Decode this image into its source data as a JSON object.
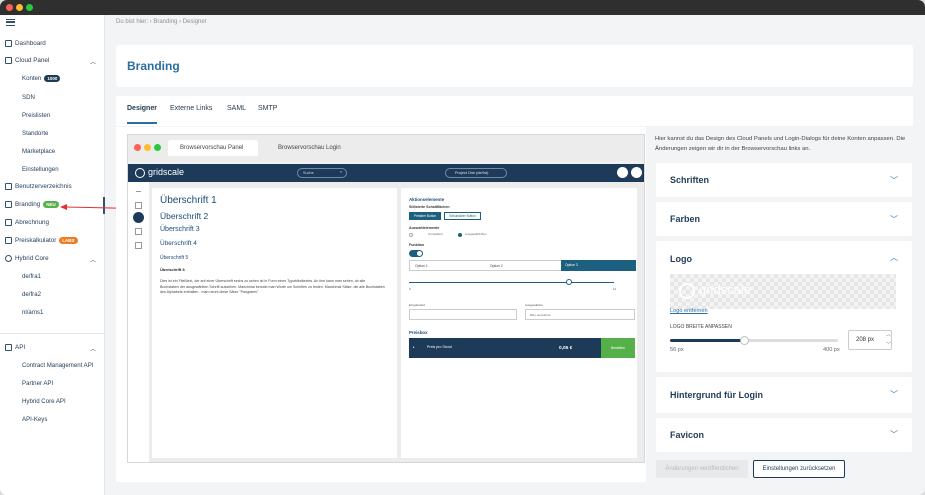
{
  "breadcrumb": "Du bist hier: › Branding › Designer",
  "page_title": "Branding",
  "sidebar": {
    "items": [
      {
        "label": "Dashboard"
      },
      {
        "label": "Cloud Panel"
      },
      {
        "label": "Konten",
        "badge": "1000"
      },
      {
        "label": "SDN"
      },
      {
        "label": "Preislisten"
      },
      {
        "label": "Standorte"
      },
      {
        "label": "Marketplace"
      },
      {
        "label": "Einstellungen"
      },
      {
        "label": "Benutzerverzeichnis"
      },
      {
        "label": "Branding",
        "badge": "NEU"
      },
      {
        "label": "Abrechnung"
      },
      {
        "label": "Preiskalkulator",
        "badge": "LABS"
      },
      {
        "label": "Hybrid Core"
      },
      {
        "label": "de/fra1"
      },
      {
        "label": "de/fra2"
      },
      {
        "label": "nl/ams1"
      },
      {
        "label": "API"
      },
      {
        "label": "Contract Management API"
      },
      {
        "label": "Partner API"
      },
      {
        "label": "Hybrid Core API"
      },
      {
        "label": "API-Keys"
      }
    ]
  },
  "tabs": [
    "Designer",
    "Externe Links",
    "SAML",
    "SMTP"
  ],
  "preview": {
    "tab1": "Browservorschau Panel",
    "tab2": "Browservorschau Login",
    "logo": "gridscale",
    "search": "Suche",
    "project": "Project One (de/fra)",
    "headings": [
      "Überschrift 1",
      "Überschrift 2",
      "Überschrift 3",
      "Überschrift 4",
      "Überschrift 5",
      "Überschrift 6"
    ],
    "body_text": "Dies ist ein Fließtext, der auf einer Überschrift sechs zu sehen ist in Form eines Typoblindtextes. An ihm kann man sehen, ob alle Buchstaben der ausgewählten Schrift aussehen. Manchmal benutzt man Worte um Schriften zu testen. Manchmal Sätze, die alle Buchstaben des Alphabets enthalten - man nennt diese Sätze \"Pangrams\".",
    "actions_title": "Aktionselemente",
    "buttons_label": "Stilisierte Schaltflächen",
    "btn_primary": "Primärer Button",
    "btn_secondary": "Sekundärer Button",
    "selection_label": "Auswahlelemente",
    "radio_a": "Unmarkiert",
    "radio_b": "Ausgewählt Box",
    "toggle_label": "Funktion",
    "options": [
      "Option 1",
      "Option 2",
      "Option 3"
    ],
    "slider_min": "0",
    "slider_max": "11",
    "input_label": "Eingabefeld",
    "input2_label": "Ausgewählen",
    "select_placeholder": "Bitte auswählen",
    "price_section": "Preisbox",
    "price_label": "Preis pro Stund",
    "price_value": "0,05 €",
    "price_button": "Bestellen"
  },
  "info_text": "Hier kannst du das Design des Cloud Panels und Login-Dialogs für deine Konten anpassen. Die Änderungen zeigen wir dir in der Browservorschau links an.",
  "accordions": {
    "schriften": "Schriften",
    "farben": "Farben",
    "logo": "Logo",
    "hintergrund": "Hintergrund für Login",
    "favicon": "Favicon"
  },
  "logo_panel": {
    "logo_text": "gridscale",
    "remove": "Logo entfernen",
    "width_label": "LOGO BREITE ANPASSEN",
    "width_value": "208 px",
    "min": "56 px",
    "max": "400 px",
    "slider_fraction": 0.44
  },
  "footer": {
    "save": "Änderungen veröffentlichen",
    "reset": "Einstellungen zurücksetzen"
  },
  "colors": {
    "accent": "#2a6ea3",
    "navy": "#1d3b59",
    "green": "#55b04a",
    "orange": "#f07c22",
    "teal": "#1d5f7e"
  }
}
